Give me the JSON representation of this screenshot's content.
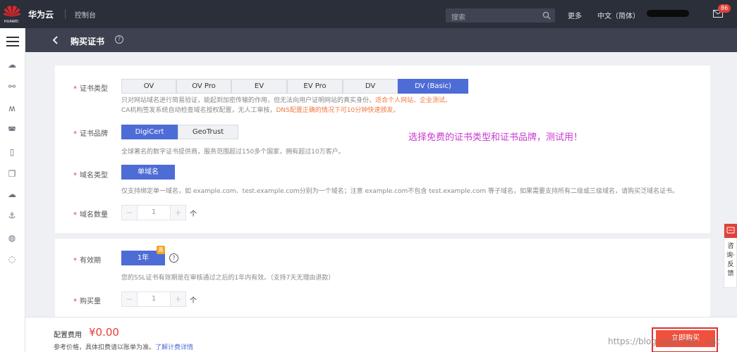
{
  "topbar": {
    "logo_text": "HUAWEI",
    "brand": "华为云",
    "console": "控制台",
    "search_placeholder": "搜索",
    "more": "更多",
    "language": "中文（简体）",
    "notification_count": "86"
  },
  "subbar": {
    "title": "购买证书",
    "help": "?"
  },
  "sidebar": {
    "icons": [
      "cloud-icon",
      "network-icon",
      "dashboard-icon",
      "storage-icon",
      "device-icon",
      "copy-icon",
      "cloud-outline-icon",
      "anchor-icon",
      "globe-icon",
      "circle-icon"
    ]
  },
  "cert_type": {
    "label": "证书类型",
    "options": [
      "OV",
      "OV Pro",
      "EV",
      "EV Pro",
      "DV",
      "DV (Basic)"
    ],
    "selected": "DV (Basic)",
    "desc1_a": "只对网站域名进行简易验证，能起到加密传输的作用，但无法向用户证明网站的真实身份，",
    "desc1_b": "适合个人网站、企业测试。",
    "desc2_a": "CA机构签发系统自动检查域名授权配置，无人工审核，",
    "desc2_b": "DNS配置正确的情况下可10分钟快速颁发。"
  },
  "cert_brand": {
    "label": "证书品牌",
    "options": [
      "DigiCert",
      "GeoTrust"
    ],
    "selected": "DigiCert",
    "desc": "全球著名的数字证书提供商，服务范围超过150多个国家，拥有超过10万客户。"
  },
  "annotation": "选择免费的证书类型和证书品牌，测试用！",
  "domain_type": {
    "label": "域名类型",
    "option": "单域名",
    "desc": "仅支持绑定单一域名，如 example.com、test.example.com分别为一个域名；注意 example.com不包含 test.example.com 等子域名，如果需要支持所有二级或三级域名，请购买泛域名证书。"
  },
  "domain_count": {
    "label": "域名数量",
    "minus": "−",
    "value": "1",
    "plus": "+",
    "unit": "个"
  },
  "validity": {
    "label": "有效期",
    "option": "1年",
    "tag": "惠",
    "help": "?",
    "desc": "您的SSL证书有效期是在审核通过之后的1年内有效。（支持7天无理由退款）"
  },
  "purchase_qty": {
    "label": "购买量",
    "minus": "−",
    "value": "1",
    "plus": "+",
    "unit": "个"
  },
  "footer": {
    "fee_label": "配置费用",
    "fee_value": "¥0.00",
    "note": "参考价格，具体扣费请以账单为准。",
    "note_link": "了解计费详情",
    "buy_button": "立即购买",
    "watermark": "https://blog.csdn.net/...ost"
  },
  "float_consult": {
    "text": "咨询·反馈"
  },
  "required_mark": "*"
}
